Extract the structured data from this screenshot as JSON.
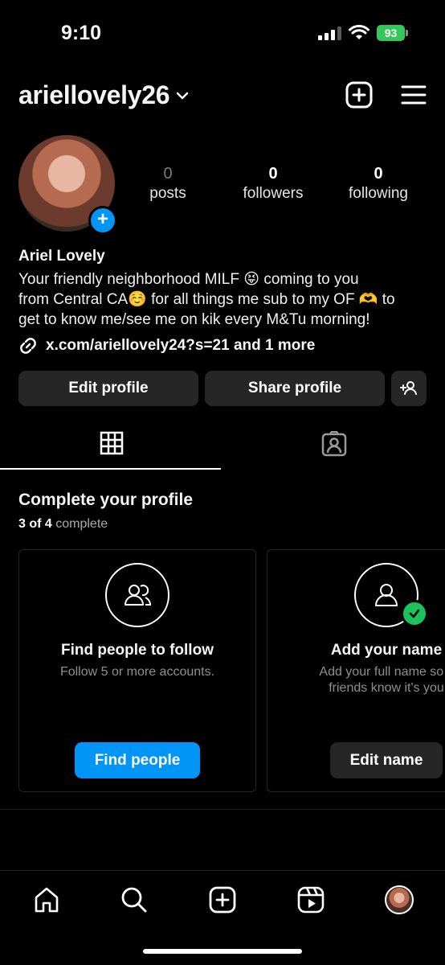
{
  "status_bar": {
    "time": "9:10",
    "battery": "93"
  },
  "header": {
    "username": "ariellovely26"
  },
  "stats": [
    {
      "value": "0",
      "label": "posts"
    },
    {
      "value": "0",
      "label": "followers"
    },
    {
      "value": "0",
      "label": "following"
    }
  ],
  "profile": {
    "name": "Ariel Lovely",
    "bio_line1": "Your friendly neighborhood MILF 😝 coming to you",
    "bio_line2": "from Central CA☺️ for all things me sub to my OF 🫶 to",
    "bio_line3": "get to know me/see me on kik every M&Tu morning!",
    "link": "x.com/ariellovely24?s=21 and 1 more"
  },
  "buttons": {
    "edit_profile": "Edit profile",
    "share_profile": "Share profile"
  },
  "complete_profile": {
    "title": "Complete your profile",
    "progress_bold": "3 of 4",
    "progress_rest": "complete",
    "cards": [
      {
        "title": "Find people to follow",
        "desc": "Follow 5 or more accounts.",
        "button": "Find people",
        "done": false
      },
      {
        "title": "Add your name",
        "desc_line1": "Add your full name so y",
        "desc_line2": "friends know it's you",
        "button": "Edit name",
        "done": true
      }
    ]
  },
  "colors": {
    "accent": "#0095f6",
    "success": "#1bc35a",
    "button_bg": "#262626"
  },
  "icons": [
    "new-post-icon",
    "menu-icon",
    "grid-icon",
    "tagged-icon",
    "home-icon",
    "search-icon",
    "create-icon",
    "reels-icon",
    "profile-avatar"
  ]
}
